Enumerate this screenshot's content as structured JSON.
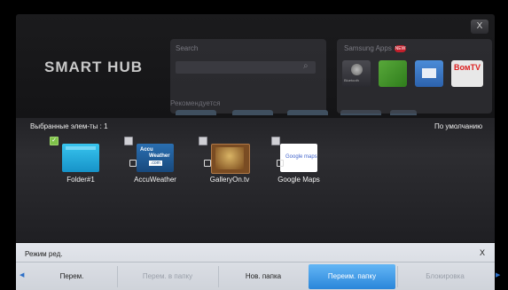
{
  "window": {
    "close_label": "X"
  },
  "brand": {
    "title": "SMART HUB"
  },
  "search": {
    "title": "Search",
    "recommended_label": "Рекомендуется"
  },
  "samsung_apps": {
    "title": "Samsung Apps",
    "badge": "NEW",
    "apps": [
      {
        "name": "Bluetooth",
        "icon": "bluetooth-app-icon"
      },
      {
        "name": "",
        "icon": "green-app-icon"
      },
      {
        "name": "",
        "icon": "mail-app-icon"
      },
      {
        "name": "ВомТV",
        "icon": "tv-app-icon"
      }
    ]
  },
  "favorites": {
    "selected_label": "Выбранные элем-ты : 1",
    "sort_label": "По умолчанию",
    "items": [
      {
        "label": "Folder#1",
        "checked": true,
        "icon": "folder-icon"
      },
      {
        "label": "AccuWeather",
        "checked": false,
        "icon": "accuweather-icon"
      },
      {
        "label": "GalleryOn.tv",
        "checked": false,
        "icon": "galleryon-icon"
      },
      {
        "label": "Google Maps",
        "checked": false,
        "icon": "google-maps-icon"
      }
    ],
    "accu_line1": "Accu",
    "accu_line2": "Weather",
    "accu_line3": ".com",
    "gmaps_text": "Google maps"
  },
  "edit_mode": {
    "title": "Режим ред.",
    "close_label": "X",
    "buttons": [
      {
        "label": "Перем.",
        "state": "normal"
      },
      {
        "label": "Перем. в папку",
        "state": "disabled"
      },
      {
        "label": "Нов. папка",
        "state": "normal"
      },
      {
        "label": "Переим. папку",
        "state": "active"
      },
      {
        "label": "Блокировка",
        "state": "disabled"
      }
    ]
  }
}
